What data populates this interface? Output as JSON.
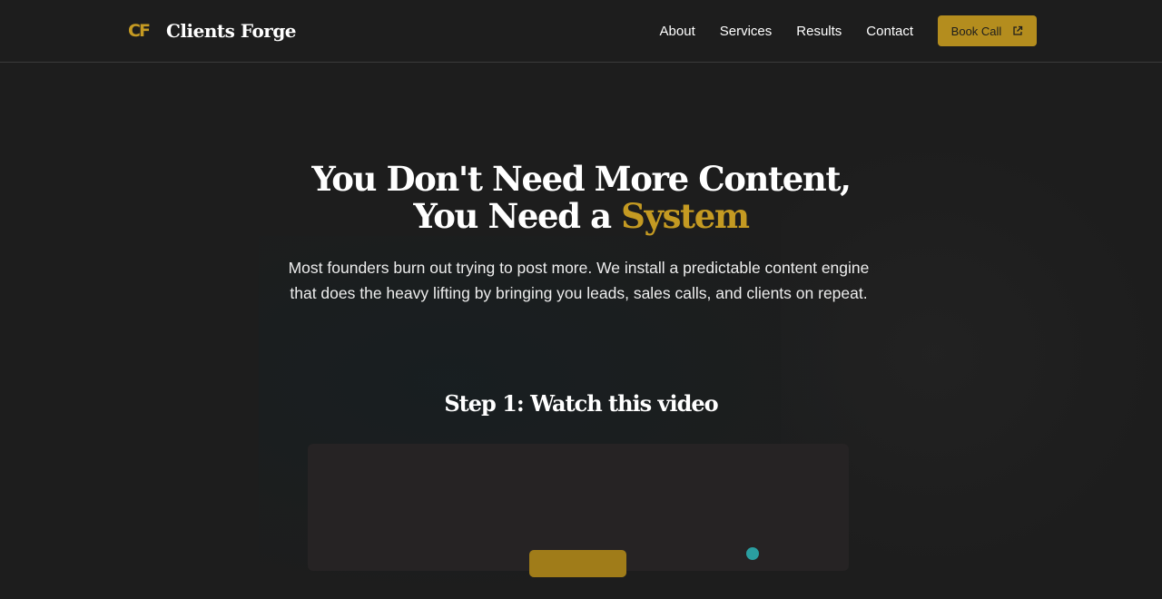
{
  "brand": {
    "mark": "CF",
    "name": "Clients Forge"
  },
  "nav": {
    "links": [
      "About",
      "Services",
      "Results",
      "Contact"
    ],
    "cta_label": "Book Call",
    "cta_icon": "external-link-icon"
  },
  "hero": {
    "title_line1": "You Don't Need More Content,",
    "title_line2_prefix": "You Need a ",
    "title_line2_accent": "System",
    "subtitle": "Most founders burn out trying to post more. We install a predictable content engine that does the heavy lifting by bringing you leads, sales calls, and clients on repeat."
  },
  "step": {
    "title": "Step 1: Watch this video"
  },
  "colors": {
    "background": "#1d1d1d",
    "accent": "#c49a22",
    "button": "#b48d1e",
    "video_bg": "#262324"
  }
}
